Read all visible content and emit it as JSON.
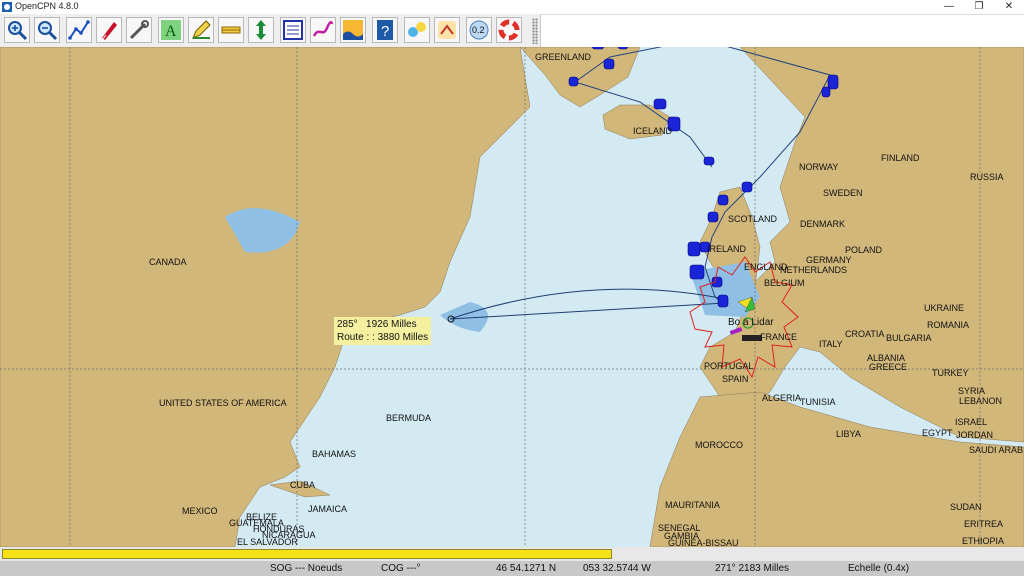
{
  "window": {
    "title": "OpenCPN 4.8.0",
    "minimize": "—",
    "restore": "❐",
    "close": "✕"
  },
  "toolbar": {
    "icons": [
      "zoom-in-icon",
      "zoom-out-icon",
      "route-icon",
      "ship-icon",
      "tools-icon",
      "anchor-text-icon",
      "pencil-icon",
      "scale-icon",
      "vertical-icon",
      "checklist-icon",
      "track-icon",
      "tide-icon",
      "help-icon",
      "settings-icon",
      "measure-icon",
      "depth-icon",
      "lifebuoy-icon"
    ],
    "depth_label": "0.2",
    "help_label": "?"
  },
  "route_info": {
    "line1": "285°   1926 Milles",
    "line2": "Route : : 3880 Milles"
  },
  "map_labels": {
    "greenland": "GREENLAND",
    "iceland": "ICELAND",
    "canada": "CANADA",
    "usa": "UNITED STATES OF AMERICA",
    "bermuda": "BERMUDA",
    "bahamas": "BAHAMAS",
    "cuba": "CUBA",
    "mexico": "MEXICO",
    "belize": "BELIZE",
    "guatemala": "GUATEMALA",
    "honduras": "HONDURAS",
    "jamaica": "JAMAICA",
    "nicaragua": "NICARAGUA",
    "el_salvador": "EL SALVADOR",
    "norway": "NORWAY",
    "finland": "FINLAND",
    "sweden": "SWEDEN",
    "russia": "RUSSIA",
    "scotland": "SCOTLAND",
    "denmark": "DENMARK",
    "ireland": "IRELAND",
    "england": "ENGLAND",
    "netherlands": "NETHERLANDS",
    "germany": "GERMANY",
    "poland": "POLAND",
    "belgium": "BELGIUM",
    "france": "FRANCE",
    "ukraine": "UKRAINE",
    "romania": "ROMANIA",
    "croatia": "CROATIA",
    "bulgaria": "BULGARIA",
    "italy": "ITALY",
    "albania": "ALBANIA",
    "greece": "GREECE",
    "turkey": "TURKEY",
    "portugal": "PORTUGAL",
    "spain": "SPAIN",
    "algeria": "ALGERIA",
    "tunisia": "TUNISIA",
    "morocco": "MOROCCO",
    "libya": "LIBYA",
    "egypt": "EGYPT",
    "syria": "SYRIA",
    "lebanon": "LEBANON",
    "israel": "ISRAEL",
    "jordan": "JORDAN",
    "saudi_arabia": "SAUDI ARAB",
    "mauritania": "MAURITANIA",
    "senegal": "SENEGAL",
    "gambia": "GAMBIA",
    "guinea_bissau": "GUINEA-BISSAU",
    "sudan": "SUDAN",
    "eritrea": "ERITREA",
    "ethiopia": "ETHIOPIA",
    "boat": "Bo a Lidar"
  },
  "progress": {
    "fraction": 1.0
  },
  "status": {
    "sog": "SOG --- Noeuds",
    "cog": "COG ---°",
    "lat": "46 54.1271 N",
    "lon": "053 32.5744 W",
    "bearing_dist": "271°  2183 Milles",
    "scale": "Echelle (0.4x)"
  }
}
